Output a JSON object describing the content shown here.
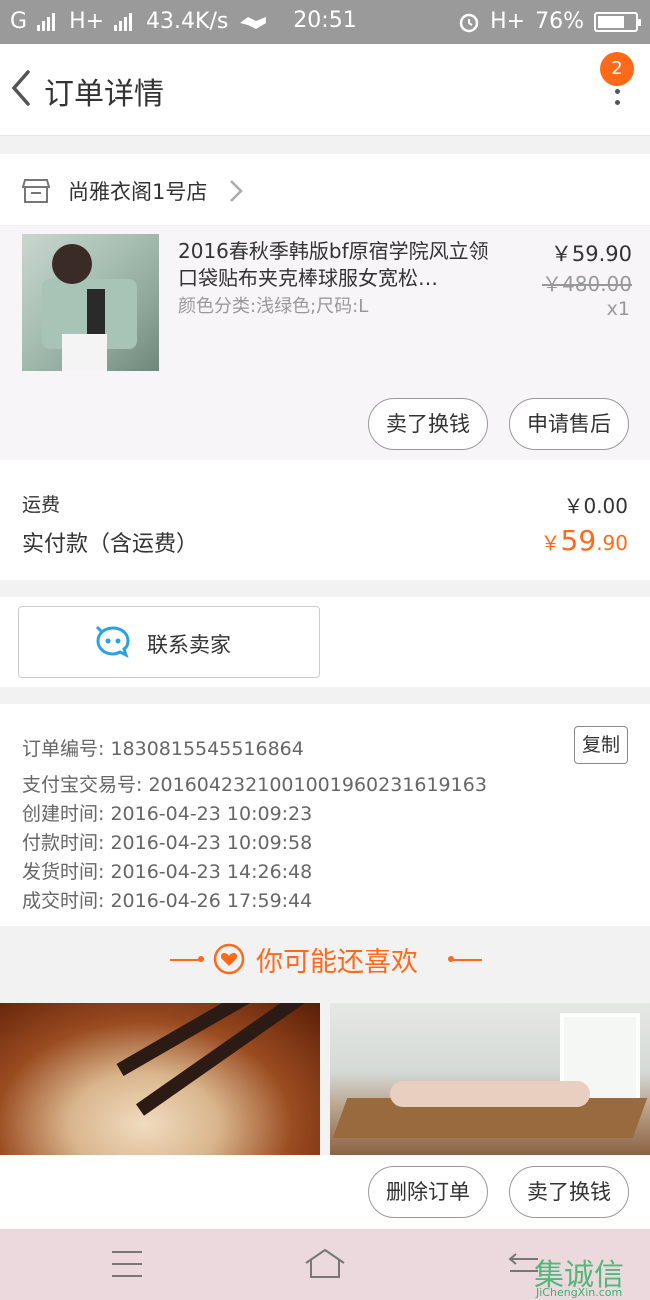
{
  "statusbar": {
    "signal_left": "G",
    "network": "H+",
    "speed": "43.4K/s",
    "time": "20:51",
    "network_right": "H+",
    "battery_pct": "76%",
    "battery_level": 0.76
  },
  "nav": {
    "title": "订单详情",
    "badge_count": "2"
  },
  "shop": {
    "name": "尚雅衣阁1号店"
  },
  "item": {
    "title": "2016春秋季韩版bf原宿学院风立领口袋贴布夹克棒球服女宽松…",
    "spec": "颜色分类:浅绿色;尺码:L",
    "price_now": "￥59.90",
    "price_old": "￥480.00",
    "qty": "x1",
    "btn_exchange": "卖了换钱",
    "btn_aftersale": "申请售后"
  },
  "fees": {
    "shipping_label": "运费",
    "shipping_value": "￥0.00",
    "paid_label": "实付款（含运费）",
    "paid_currency": "￥",
    "paid_int": "59",
    "paid_dec": ".90"
  },
  "contact": {
    "label": "联系卖家"
  },
  "order_info": {
    "copy_label": "复制",
    "lines": [
      "订单编号: 1830815545516864",
      "支付宝交易号: 2016042321001001960231619163",
      "创建时间: 2016-04-23 10:09:23",
      "付款时间: 2016-04-23 10:09:58",
      "发货时间: 2016-04-23 14:26:48",
      "成交时间: 2016-04-26 17:59:44"
    ]
  },
  "recommend": {
    "title": "你可能还喜欢"
  },
  "actions": {
    "delete": "删除订单",
    "exchange": "卖了换钱"
  },
  "watermark": {
    "main": "集诚信",
    "sub": "JiChengXin.com"
  },
  "colors": {
    "accent": "#ff6a1a",
    "contact_icon": "#2aa0e6"
  }
}
